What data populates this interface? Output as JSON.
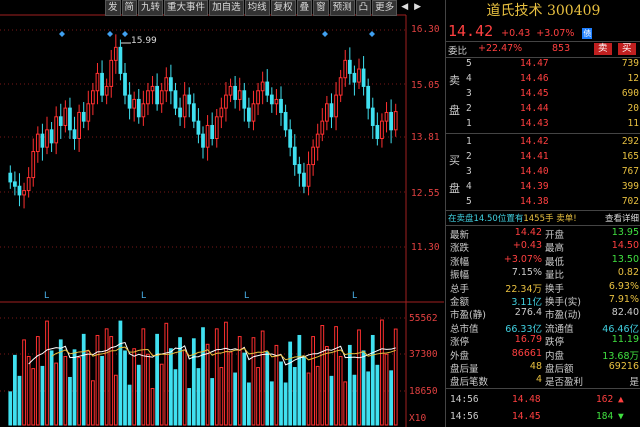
{
  "toolbar": {
    "items": [
      "发",
      "简",
      "九转",
      "重大事件",
      "加自选",
      "均线",
      "复权",
      "叠",
      "窗",
      "预测",
      "凸",
      "更多"
    ],
    "prev_arrow": "◀",
    "next_arrow": "▶"
  },
  "price_axis": {
    "labels": [
      "16.30",
      "15.05",
      "13.81",
      "12.55",
      "11.30"
    ]
  },
  "volume_axis": {
    "labels": [
      "55562",
      "37300",
      "18650"
    ],
    "unit": "X10"
  },
  "chart": {
    "high_marker": "15.99",
    "ma_marks": [
      "L",
      "L",
      "L",
      "L"
    ]
  },
  "colors": {
    "up": "#ff3030",
    "down": "#40e0f0",
    "accent": "#e8c040",
    "grid": "#a02020"
  },
  "quote": {
    "title": "道氏技术 300409",
    "price": "14.42",
    "change": "+0.43",
    "change_pct": "+3.07%",
    "badge": "债",
    "ratio_label": "委比",
    "ratio_value": "+22.47%",
    "ratio_diff": "853",
    "sell_btn": "卖",
    "buy_btn": "买"
  },
  "sell_side_label": [
    "卖",
    "盘"
  ],
  "buy_side_label": [
    "买",
    "盘"
  ],
  "sell_orders": [
    {
      "level": "5",
      "price": "14.47",
      "vol": "739"
    },
    {
      "level": "4",
      "price": "14.46",
      "vol": "12"
    },
    {
      "level": "3",
      "price": "14.45",
      "vol": "690"
    },
    {
      "level": "2",
      "price": "14.44",
      "vol": "20"
    },
    {
      "level": "1",
      "price": "14.43",
      "vol": "11"
    }
  ],
  "buy_orders": [
    {
      "level": "1",
      "price": "14.42",
      "vol": "292"
    },
    {
      "level": "2",
      "price": "14.41",
      "vol": "165"
    },
    {
      "level": "3",
      "price": "14.40",
      "vol": "767"
    },
    {
      "level": "4",
      "price": "14.39",
      "vol": "399"
    },
    {
      "level": "5",
      "price": "14.38",
      "vol": "702"
    }
  ],
  "notice": {
    "text": "在卖盘14.50位置有",
    "vol": "1455手",
    "label": "卖单!",
    "detail": "查看详细"
  },
  "stats": [
    {
      "l1": "最新",
      "v1": "14.42",
      "c1": "#ff4040",
      "l2": "开盘",
      "v2": "13.95",
      "c2": "#40e040"
    },
    {
      "l1": "涨跌",
      "v1": "+0.43",
      "c1": "#ff4040",
      "l2": "最高",
      "v2": "14.50",
      "c2": "#ff4040"
    },
    {
      "l1": "涨幅",
      "v1": "+3.07%",
      "c1": "#ff4040",
      "l2": "最低",
      "v2": "13.50",
      "c2": "#40e040"
    },
    {
      "l1": "振幅",
      "v1": "7.15%",
      "c1": "#ccc",
      "l2": "量比",
      "v2": "0.82",
      "c2": "#e8c040"
    },
    {
      "l1": "总手",
      "v1": "22.34万",
      "c1": "#e8c040",
      "l2": "换手",
      "v2": "6.93%",
      "c2": "#e8c040"
    },
    {
      "l1": "金额",
      "v1": "3.11亿",
      "c1": "#40d0e0",
      "l2": "换手(实)",
      "v2": "7.91%",
      "c2": "#e8c040"
    },
    {
      "l1": "市盈(静)",
      "v1": "276.4",
      "c1": "#ccc",
      "l2": "市盈(动)",
      "v2": "82.40",
      "c2": "#ccc"
    },
    {
      "l1": "总市值",
      "v1": "66.33亿",
      "c1": "#40d0e0",
      "l2": "流通值",
      "v2": "46.46亿",
      "c2": "#40d0e0"
    },
    {
      "l1": "涨停",
      "v1": "16.79",
      "c1": "#ff4040",
      "l2": "跌停",
      "v2": "11.19",
      "c2": "#40e040"
    },
    {
      "l1": "外盘",
      "v1": "86661",
      "c1": "#ff4040",
      "l2": "内盘",
      "v2": "13.68万",
      "c2": "#40e040"
    },
    {
      "l1": "盘后量",
      "v1": "48",
      "c1": "#e8c040",
      "l2": "盘后额",
      "v2": "69216",
      "c2": "#e8c040"
    },
    {
      "l1": "盘后笔数",
      "v1": "4",
      "c1": "#e8c040",
      "l2": "是否盈利",
      "v2": "是",
      "c2": "#ccc"
    }
  ],
  "ticks": [
    {
      "time": "14:56",
      "price": "14.48",
      "vol": "162",
      "dir": "up"
    },
    {
      "time": "14:56",
      "price": "14.45",
      "vol": "184",
      "dir": "down"
    }
  ]
}
